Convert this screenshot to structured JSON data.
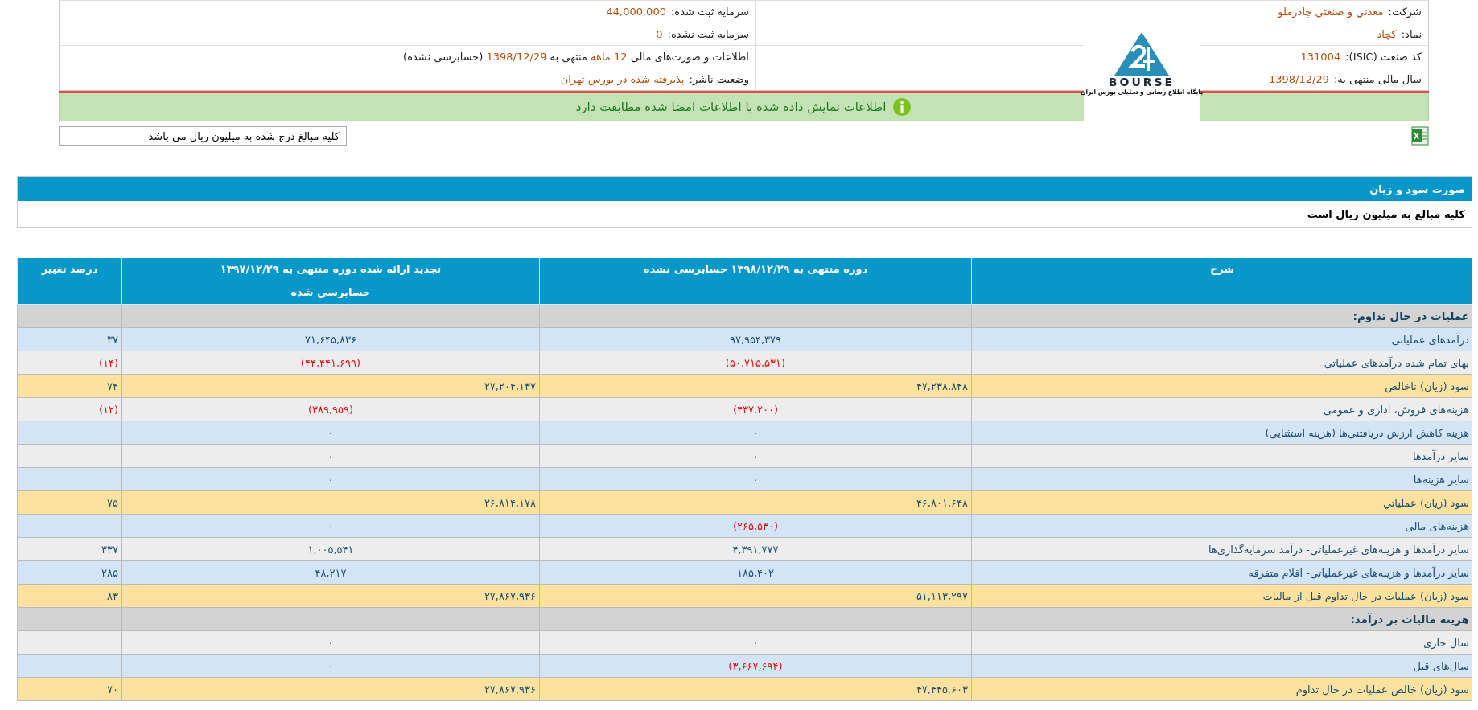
{
  "info": {
    "rows": [
      {
        "right": {
          "label": "شرکت:",
          "value": "معدني و صنعتي چادرملو"
        },
        "left": {
          "label": "سرمایه ثبت شده:",
          "value": "44,000,000"
        }
      },
      {
        "right": {
          "label": "نماد:",
          "value": "کچاد"
        },
        "left": {
          "label": "سرمایه ثبت نشده:",
          "value": "0"
        }
      },
      {
        "right": {
          "label": "کد صنعت (ISIC):",
          "value": "131004"
        },
        "left": {
          "parts": [
            {
              "text": "اطلاعات و صورت‌های مالی",
              "accent": false
            },
            {
              "text": "12 ماهه",
              "accent": true
            },
            {
              "text": "منتهی به",
              "accent": false
            },
            {
              "text": "1398/12/29",
              "accent": true
            },
            {
              "text": "(حسابرسی نشده)",
              "accent": false
            }
          ]
        }
      },
      {
        "right": {
          "label": "سال مالی منتهی به:",
          "value": "1398/12/29"
        },
        "left": {
          "label": "وضعیت ناشر:",
          "value": "پذیرفته شده در بورس تهران"
        }
      }
    ]
  },
  "logo": {
    "name": "BOURSE",
    "tagline": "پایگاه اطلاع رسانی و تحلیلی بورس ایران"
  },
  "notice": "اطلاعات نمایش داده شده با اطلاعات امضا شده مطابقت دارد",
  "amount_note": "کلیه مبالغ درج شده به میلیون ریال می باشد",
  "section": {
    "title": "صورت سود و زیان",
    "subtitle": "کلیه مبالغ به میلیون ریال است"
  },
  "table": {
    "columns": {
      "description": "شرح",
      "current": "دوره منتهی به ۱۳۹۸/۱۲/۲۹ حسابرسی نشده",
      "previous": "تجدید ارائه شده دوره منتهی به ۱۳۹۷/۱۲/۲۹",
      "previous_sub": "حسابرسی شده",
      "change": "درصد تغییر"
    },
    "rows": [
      {
        "kind": "section",
        "desc": "عملیات در حال تداوم:"
      },
      {
        "kind": "band",
        "desc": "درآمدهای عملیاتی",
        "cur": {
          "t": "۹۷,۹۵۴,۳۷۹",
          "neg": false
        },
        "prev": {
          "t": "۷۱,۶۴۵,۸۳۶",
          "neg": false
        },
        "pct": {
          "t": "۳۷",
          "neg": false
        }
      },
      {
        "kind": "plain",
        "desc": "بهای تمام شده درآمدهای عملیاتی",
        "cur": {
          "t": "(۵۰,۷۱۵,۵۳۱)",
          "neg": true
        },
        "prev": {
          "t": "(۴۴,۴۴۱,۶۹۹)",
          "neg": true
        },
        "pct": {
          "t": "(۱۴)",
          "neg": true
        }
      },
      {
        "kind": "total",
        "desc": "سود (زیان) ناخالص",
        "cur": {
          "t": "۴۷,۲۳۸,۸۴۸",
          "neg": false
        },
        "prev": {
          "t": "۲۷,۲۰۴,۱۳۷",
          "neg": false
        },
        "pct": {
          "t": "۷۴",
          "neg": false
        }
      },
      {
        "kind": "plain",
        "desc": "هزینه‌های فروش، اداری و عمومی",
        "cur": {
          "t": "(۴۳۷,۲۰۰)",
          "neg": true
        },
        "prev": {
          "t": "(۳۸۹,۹۵۹)",
          "neg": true
        },
        "pct": {
          "t": "(۱۲)",
          "neg": true
        }
      },
      {
        "kind": "band",
        "desc": "هزینه کاهش ارزش دریافتنی‌ها (هزینه استثنایی)",
        "cur": {
          "t": "۰",
          "neg": false
        },
        "prev": {
          "t": "۰",
          "neg": false
        }
      },
      {
        "kind": "plain",
        "desc": "سایر درآمدها",
        "cur": {
          "t": "۰",
          "neg": false
        },
        "prev": {
          "t": "۰",
          "neg": false
        }
      },
      {
        "kind": "band",
        "desc": "سایر هزینه‌ها",
        "cur": {
          "t": "۰",
          "neg": false
        },
        "prev": {
          "t": "۰",
          "neg": false
        }
      },
      {
        "kind": "total",
        "desc": "سود (زیان) عملیاتي",
        "cur": {
          "t": "۴۶,۸۰۱,۶۴۸",
          "neg": false
        },
        "prev": {
          "t": "۲۶,۸۱۴,۱۷۸",
          "neg": false
        },
        "pct": {
          "t": "۷۵",
          "neg": false
        }
      },
      {
        "kind": "band",
        "desc": "هزینه‌های مالی",
        "cur": {
          "t": "(۲۶۵,۵۳۰)",
          "neg": true
        },
        "prev": {
          "t": "۰",
          "neg": false
        },
        "pct": {
          "t": "--",
          "neg": false
        }
      },
      {
        "kind": "plain",
        "desc": "سایر درآمدها و هزینه‌های غیرعملیاتی- درآمد سرمایه‌گذاری‌ها",
        "cur": {
          "t": "۴,۳۹۱,۷۷۷",
          "neg": false
        },
        "prev": {
          "t": "۱,۰۰۵,۵۴۱",
          "neg": false
        },
        "pct": {
          "t": "۳۳۷",
          "neg": false
        }
      },
      {
        "kind": "band",
        "desc": "سایر درآمدها و هزینه‌های غیرعملیاتی- اقلام متفرقه",
        "cur": {
          "t": "۱۸۵,۴۰۲",
          "neg": false
        },
        "prev": {
          "t": "۴۸,۲۱۷",
          "neg": false
        },
        "pct": {
          "t": "۲۸۵",
          "neg": false
        }
      },
      {
        "kind": "total",
        "desc": "سود (زیان) عملیات در حال تداوم قبل از مالیات",
        "cur": {
          "t": "۵۱,۱۱۳,۲۹۷",
          "neg": false
        },
        "prev": {
          "t": "۲۷,۸۶۷,۹۳۶",
          "neg": false
        },
        "pct": {
          "t": "۸۳",
          "neg": false
        }
      },
      {
        "kind": "section",
        "desc": "هزینه مالیات بر درآمد:"
      },
      {
        "kind": "plain",
        "desc": "سال جاری",
        "cur": {
          "t": "۰",
          "neg": false
        },
        "prev": {
          "t": "۰",
          "neg": false
        }
      },
      {
        "kind": "band",
        "desc": "سال‌های قبل",
        "cur": {
          "t": "(۳,۶۶۷,۶۹۴)",
          "neg": true
        },
        "prev": {
          "t": "۰",
          "neg": false
        },
        "pct": {
          "t": "--",
          "neg": false
        }
      },
      {
        "kind": "total",
        "desc": "سود (زیان) خالص عملیات در حال تداوم",
        "cur": {
          "t": "۴۷,۴۴۵,۶۰۳",
          "neg": false
        },
        "prev": {
          "t": "۲۷,۸۶۷,۹۳۶",
          "neg": false
        },
        "pct": {
          "t": "۷۰",
          "neg": false
        }
      }
    ]
  }
}
